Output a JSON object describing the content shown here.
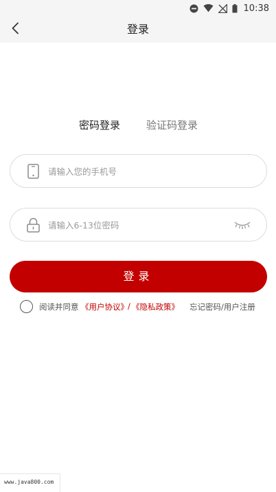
{
  "status_bar": {
    "time": "10:38",
    "icons": [
      "do-not-disturb-icon",
      "wifi-icon",
      "signal-off-icon",
      "battery-icon"
    ]
  },
  "nav": {
    "title": "登录",
    "back_icon": "chevron-left-icon"
  },
  "tabs": [
    {
      "label": "密码登录",
      "active": true
    },
    {
      "label": "验证码登录",
      "active": false
    }
  ],
  "phone_field": {
    "placeholder": "请输入您的手机号",
    "value": "",
    "icon": "phone-icon"
  },
  "password_field": {
    "placeholder": "请输入6-13位密码",
    "value": "",
    "icon": "lock-icon",
    "toggle_icon": "eye-closed-icon"
  },
  "login_button": {
    "label": "登录"
  },
  "agreement": {
    "prefix": "阅读并同意",
    "user_agreement": "《用户协议》",
    "separator": "/",
    "privacy_policy": "《隐私政策》",
    "forgot_register": "忘记密码/用户注册"
  },
  "watermark": {
    "text": "www.java800.com"
  },
  "colors": {
    "accent": "#c20000",
    "header_bg": "#f5f5f5",
    "border": "#dcdcdc"
  }
}
